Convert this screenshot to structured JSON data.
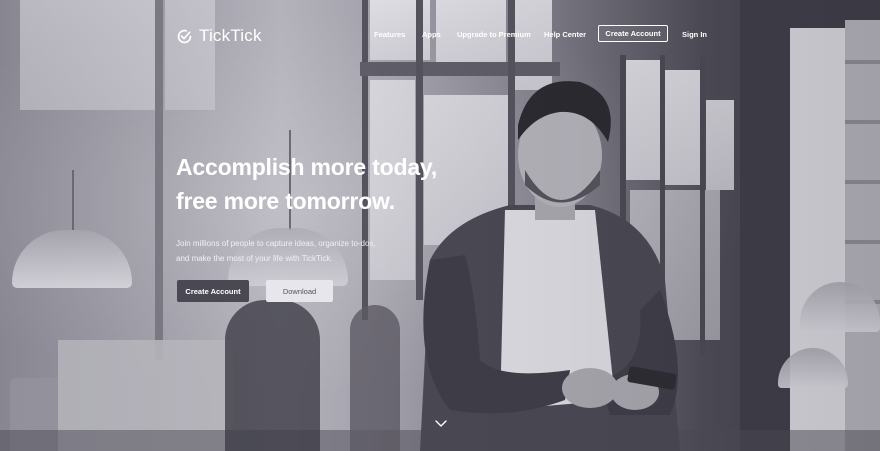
{
  "brand": {
    "name": "TickTick",
    "logo_icon": "ticktick-check-circle-icon"
  },
  "nav": {
    "items": [
      {
        "label": "Features"
      },
      {
        "label": "Apps"
      },
      {
        "label": "Upgrade to Premium"
      },
      {
        "label": "Help Center"
      }
    ],
    "create_account": "Create Account",
    "sign_in": "Sign In"
  },
  "hero": {
    "headline_line1": "Accomplish more today,",
    "headline_line2": "free more tomorrow.",
    "subtext_line1": "Join millions of people to capture ideas, organize to-dos,",
    "subtext_line2": "and make the most of your life with TickTick.",
    "cta_primary": "Create Account",
    "cta_secondary": "Download",
    "scroll_icon": "chevron-down-icon"
  },
  "colors": {
    "text": "#ffffff",
    "primary_button_bg": "#4a4852",
    "secondary_button_bg": "#e7e6ec"
  }
}
